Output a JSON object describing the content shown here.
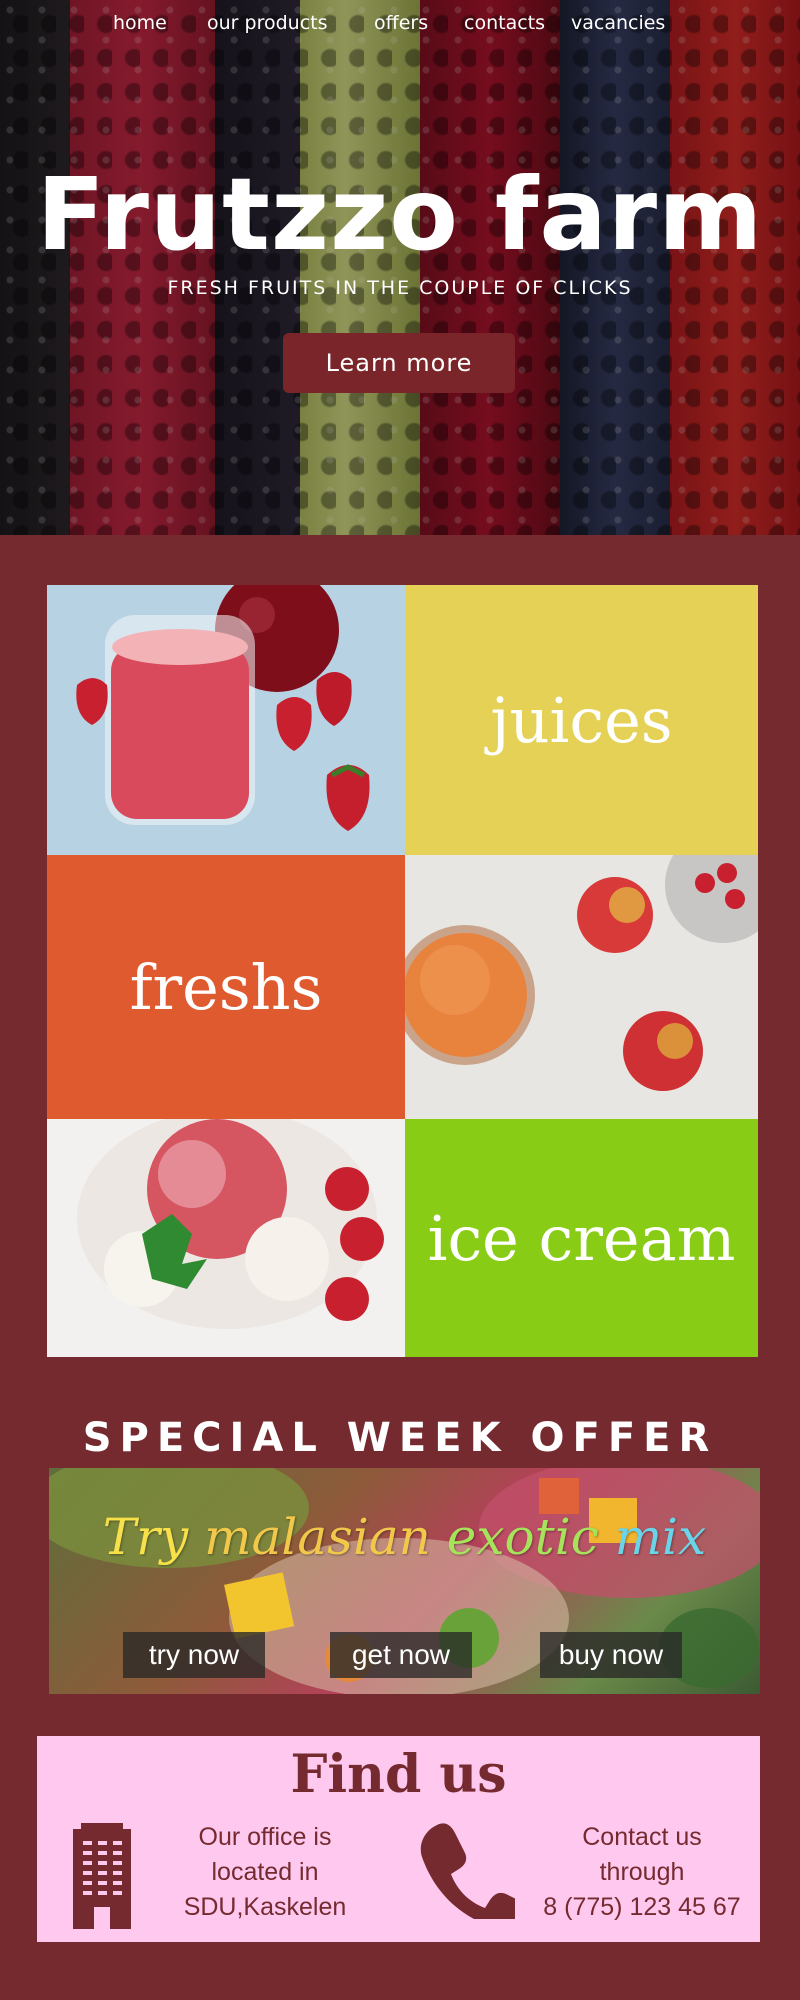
{
  "nav": {
    "items": [
      "home",
      "our products",
      "offers",
      "contacts",
      "vacancies"
    ]
  },
  "hero": {
    "title": "Frutzzo farm",
    "subtitle": "FRESH FRUITS IN THE COUPLE OF CLICKS",
    "button_label": "Learn more"
  },
  "products": {
    "juices": "juices",
    "freshs": "freshs",
    "ice_cream": "ice cream"
  },
  "offer": {
    "title": "SPECIAL WEEK OFFER",
    "tagline_words": [
      "Try",
      "malasian",
      "exotic",
      "mix"
    ],
    "buttons": [
      "try now",
      "get now",
      "buy now"
    ]
  },
  "find": {
    "title": "Find us",
    "office_lines": [
      "Our office is",
      "located in",
      "SDU,Kaskelen"
    ],
    "contact_lines": [
      "Contact us",
      "through",
      "8 (775) 123 45 67"
    ]
  },
  "colors": {
    "page_background": "#742a2f",
    "juices_tile": "#e4d155",
    "freshs_tile": "#e05a30",
    "ice_cream_tile": "#88cc16",
    "find_background": "#ffc9ef",
    "accent_text": "#742a2f",
    "tagline": [
      "#f7e04a",
      "#f2c84a",
      "#a6e35a",
      "#6ad4e8"
    ]
  },
  "icons": [
    "office-building-icon",
    "phone-icon"
  ]
}
